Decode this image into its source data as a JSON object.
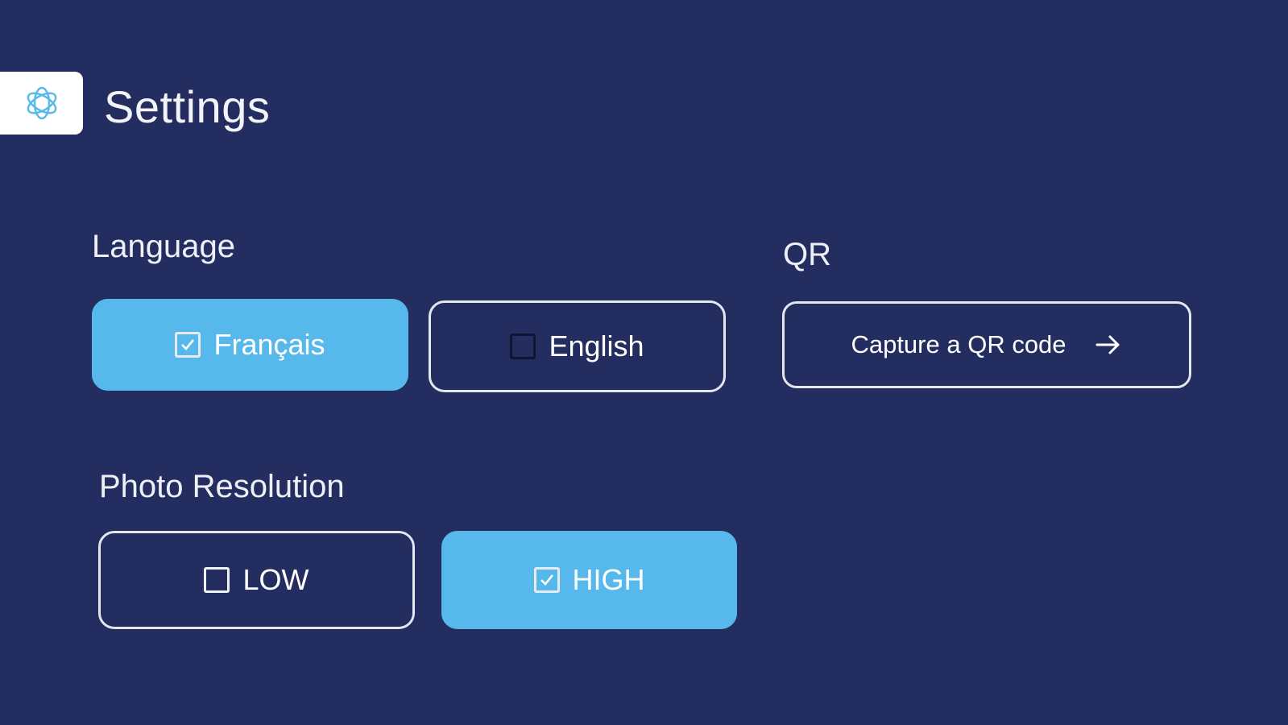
{
  "header": {
    "title": "Settings",
    "icon": "settings-flower-icon"
  },
  "language": {
    "label": "Language",
    "options": [
      {
        "label": "Français",
        "selected": true
      },
      {
        "label": "English",
        "selected": false
      }
    ]
  },
  "qr": {
    "label": "QR",
    "button_label": "Capture a QR code",
    "button_icon": "arrow-right-icon"
  },
  "photo_resolution": {
    "label": "Photo Resolution",
    "options": [
      {
        "label": "LOW",
        "selected": false
      },
      {
        "label": "HIGH",
        "selected": true
      }
    ]
  },
  "colors": {
    "background": "#232d5f",
    "accent": "#56b8eb",
    "border": "#e4e7f0"
  }
}
